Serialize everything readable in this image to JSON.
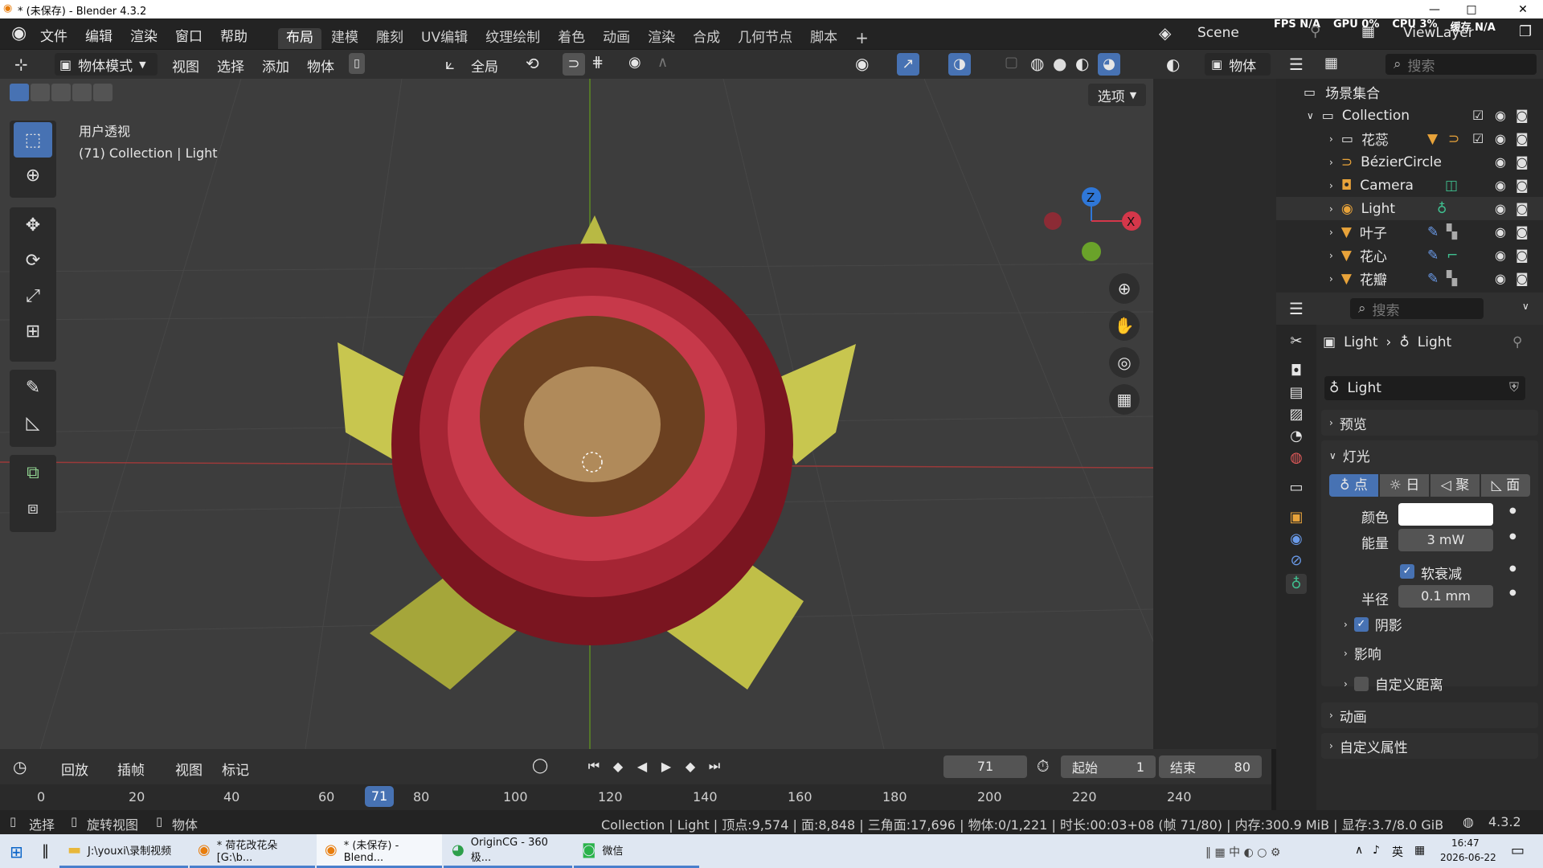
{
  "window": {
    "title": "* (未保存) - Blender 4.3.2",
    "min": "—",
    "max": "□",
    "close": "✕"
  },
  "menu": [
    "文件",
    "编辑",
    "渲染",
    "窗口",
    "帮助"
  ],
  "workspaces": [
    "布局",
    "建模",
    "雕刻",
    "UV编辑",
    "纹理绘制",
    "着色",
    "动画",
    "渲染",
    "合成",
    "几何节点",
    "脚本"
  ],
  "add_ws": "+",
  "scene": {
    "label": "Scene",
    "viewlayer": "ViewLayer"
  },
  "stats_top": {
    "fps": "FPS N/A",
    "gpu": "GPU 0%",
    "cpu": "CPU 3%",
    "mem": "缓存 N/A"
  },
  "header3d": {
    "mode": "物体模式",
    "view": "视图",
    "select": "选择",
    "add": "添加",
    "object": "物体",
    "orientation": "全局",
    "options": "选项",
    "object_right": "物体"
  },
  "viewport": {
    "line1": "用户透视",
    "line2": "(71) Collection | Light",
    "gizmo_z": "Z",
    "gizmo_x": "X"
  },
  "outliner": {
    "search_placeholder": "搜索",
    "root": "场景集合",
    "collection": "Collection",
    "items": [
      "花蕊",
      "BézierCircle",
      "Camera",
      "Light",
      "叶子",
      "花心",
      "花瓣"
    ]
  },
  "props": {
    "search_placeholder": "搜索",
    "breadcrumb_a": "Light",
    "breadcrumb_b": "Light",
    "datablock": "Light",
    "preview": "预览",
    "light": "灯光",
    "types": [
      "点",
      "日",
      "聚",
      "面"
    ],
    "color_label": "颜色",
    "color_value": "#ffffff",
    "power_label": "能量",
    "power_value": "3 mW",
    "soft_falloff": "软衰减",
    "radius_label": "半径",
    "radius_value": "0.1 mm",
    "shadow": "阴影",
    "influence": "影响",
    "custom_distance": "自定义距离",
    "animation": "动画",
    "custom_props": "自定义属性"
  },
  "timeline": {
    "playback": "回放",
    "keying": "插帧",
    "view": "视图",
    "marker": "标记",
    "current": "71",
    "start_label": "起始",
    "start": "1",
    "end_label": "结束",
    "end": "80",
    "ticks": [
      "0",
      "20",
      "40",
      "60",
      "71",
      "80",
      "100",
      "120",
      "140",
      "160",
      "180",
      "200",
      "220",
      "240"
    ]
  },
  "statusbar": {
    "select": "选择",
    "rotate": "旋转视图",
    "object": "物体",
    "info": "Collection | Light | 顶点:9,574 | 面:8,848 | 三角面:17,696 | 物体:0/1,221 | 时长:00:03+08 (帧 71/80) | 内存:300.9 MiB | 显存:3.7/8.0 GiB",
    "version": "4.3.2"
  },
  "taskbar": {
    "apps": [
      "J:\\youxi\\录制视频",
      "* 荷花改花朵 [G:\\b...",
      "* (未保存) - Blend...",
      "OriginCG - 360极...",
      "微信"
    ],
    "tray": "英",
    "time": "16:47",
    "date": "2026-06-22"
  }
}
